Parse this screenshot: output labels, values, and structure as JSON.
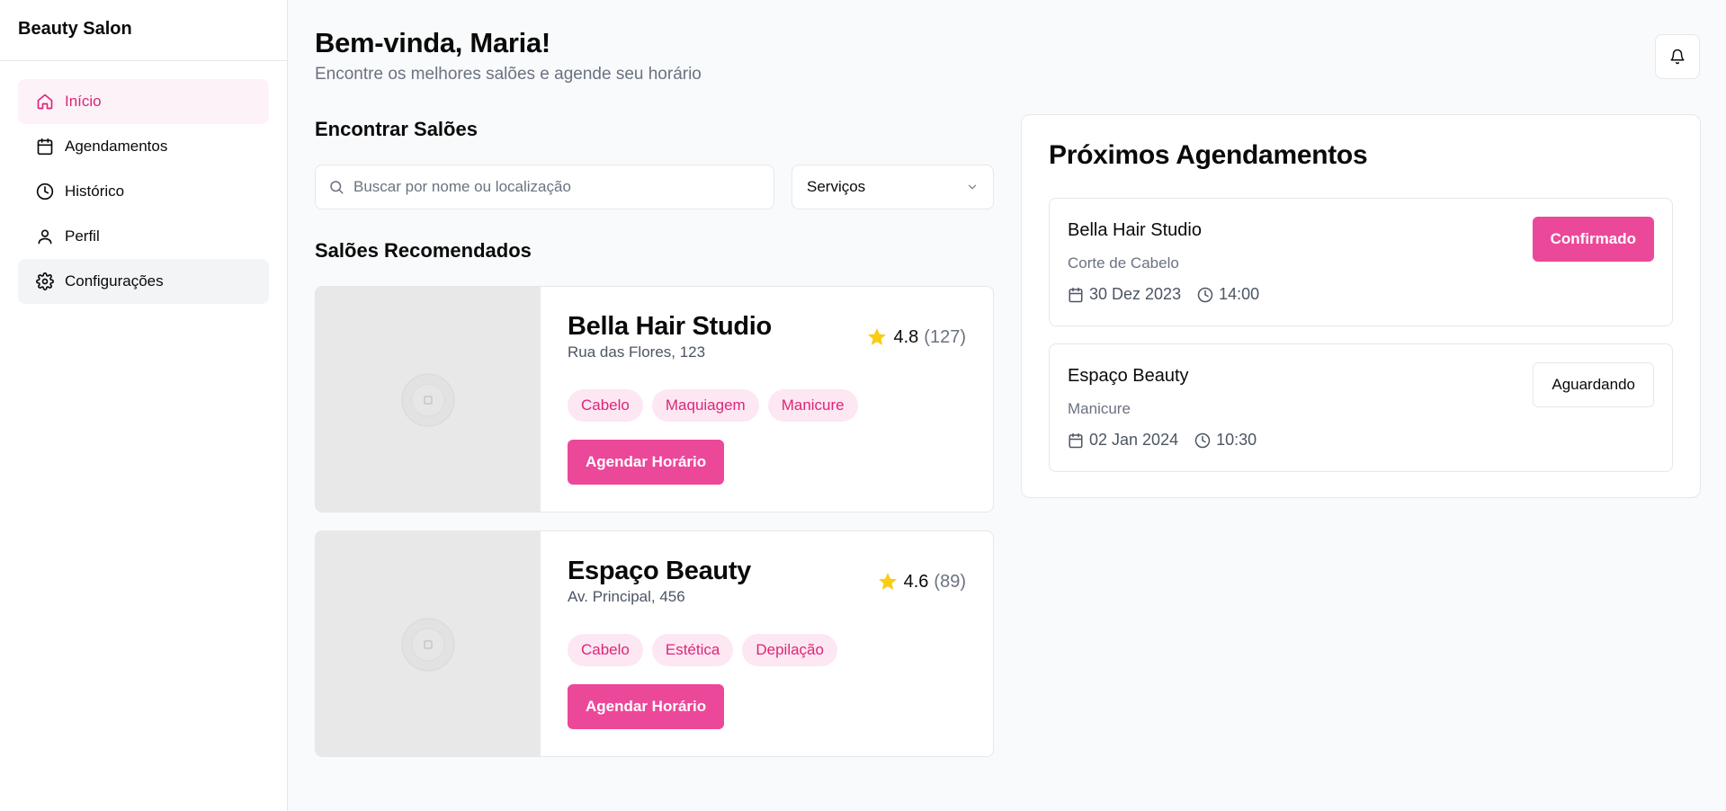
{
  "sidebar": {
    "brand": "Beauty Salon",
    "items": [
      {
        "label": "Início",
        "icon": "home-icon"
      },
      {
        "label": "Agendamentos",
        "icon": "calendar-icon"
      },
      {
        "label": "Histórico",
        "icon": "clock-icon"
      },
      {
        "label": "Perfil",
        "icon": "user-icon"
      },
      {
        "label": "Configurações",
        "icon": "gear-icon"
      }
    ],
    "active_item": "Início"
  },
  "header": {
    "title": "Bem-vinda, Maria!",
    "subtitle": "Encontre os melhores salões e agende seu horário",
    "bell_icon": "bell-icon"
  },
  "search": {
    "section_title": "Encontrar Salões",
    "placeholder": "Buscar por nome ou localização",
    "value": "",
    "services_selected": "Serviços"
  },
  "recommended": {
    "section_title": "Salões Recomendados",
    "salons": [
      {
        "name": "Bella Hair Studio",
        "address": "Rua das Flores, 123",
        "rating": "4.8",
        "reviews": "(127)",
        "tags": [
          "Cabelo",
          "Maquiagem",
          "Manicure"
        ],
        "button": "Agendar Horário"
      },
      {
        "name": "Espaço Beauty",
        "address": "Av. Principal, 456",
        "rating": "4.6",
        "reviews": "(89)",
        "tags": [
          "Cabelo",
          "Estética",
          "Depilação"
        ],
        "button": "Agendar Horário"
      }
    ]
  },
  "upcoming": {
    "title": "Próximos Agendamentos",
    "appointments": [
      {
        "salon": "Bella Hair Studio",
        "service": "Corte de Cabelo",
        "date": "30 Dez 2023",
        "time": "14:00",
        "status": "Confirmado"
      },
      {
        "salon": "Espaço Beauty",
        "service": "Manicure",
        "date": "02 Jan 2024",
        "time": "10:30",
        "status": "Aguardando"
      }
    ]
  },
  "colors": {
    "accent": "#ec4899",
    "accent_text": "#db2777",
    "accent_soft": "#fce7f3",
    "star": "#facc15"
  }
}
